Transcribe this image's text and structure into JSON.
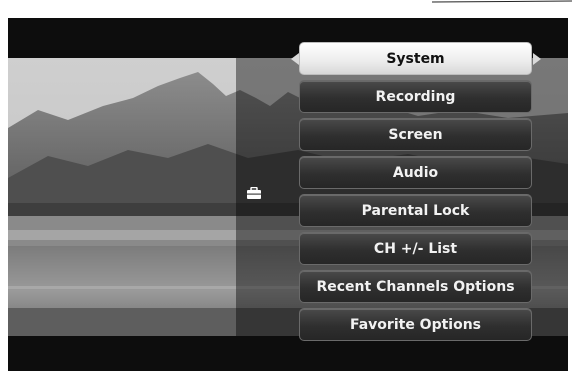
{
  "menu": {
    "items": [
      {
        "label": "System",
        "selected": true
      },
      {
        "label": "Recording",
        "selected": false
      },
      {
        "label": "Screen",
        "selected": false
      },
      {
        "label": "Audio",
        "selected": false
      },
      {
        "label": "Parental Lock",
        "selected": false
      },
      {
        "label": "CH +/- List",
        "selected": false
      },
      {
        "label": "Recent Channels Options",
        "selected": false
      },
      {
        "label": "Favorite Options",
        "selected": false
      }
    ]
  },
  "icons": {
    "category": "toolbox-icon",
    "left_arrow": "arrow-left-icon",
    "right_arrow": "arrow-right-icon"
  },
  "colors": {
    "background": "#0b0b0b",
    "item_bg": "#2f2f2f",
    "item_text": "#f2f2f2",
    "selected_bg": "#f4f4f4",
    "selected_text": "#111111"
  }
}
